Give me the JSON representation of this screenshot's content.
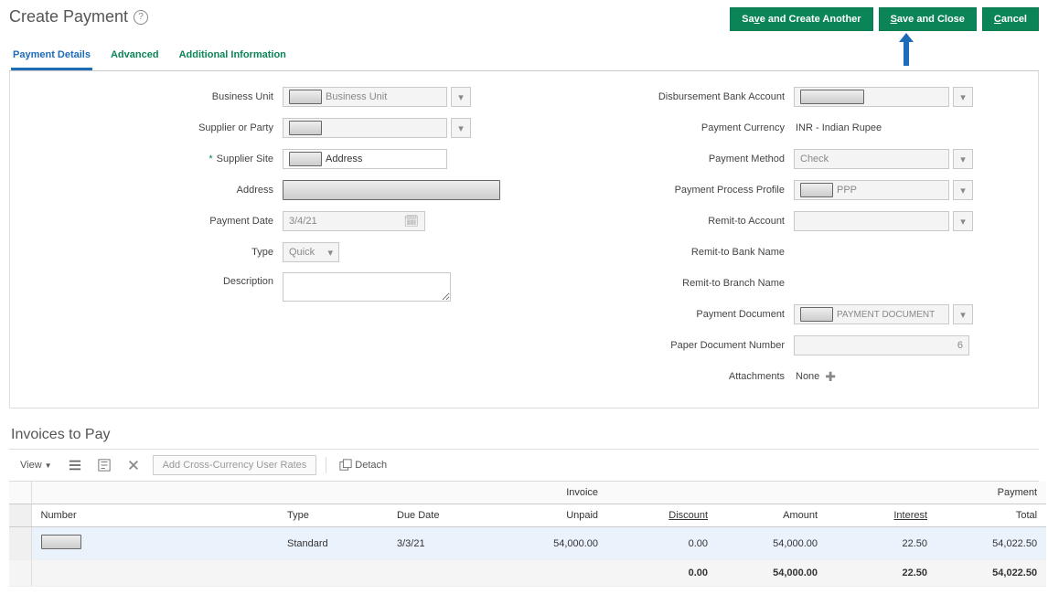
{
  "header": {
    "title": "Create Payment",
    "buttons": {
      "save_another": {
        "prefix": "Sa",
        "u": "v",
        "suffix": "e and Create Another"
      },
      "save_close": {
        "prefix": "",
        "u": "S",
        "suffix": "ave and Close"
      },
      "cancel": {
        "prefix": "",
        "u": "C",
        "suffix": "ancel"
      }
    }
  },
  "tabs": [
    "Payment Details",
    "Advanced",
    "Additional Information"
  ],
  "active_tab": 0,
  "left": {
    "business_unit": {
      "label": "Business Unit",
      "placeholder": "Business Unit"
    },
    "supplier_party": {
      "label": "Supplier or Party"
    },
    "supplier_site": {
      "label": "Supplier Site",
      "placeholder": "Address"
    },
    "address": {
      "label": "Address"
    },
    "payment_date": {
      "label": "Payment Date",
      "value": "3/4/21"
    },
    "type": {
      "label": "Type",
      "value": "Quick"
    },
    "description": {
      "label": "Description"
    }
  },
  "right": {
    "disb_bank": {
      "label": "Disbursement Bank Account"
    },
    "currency": {
      "label": "Payment Currency",
      "value": "INR - Indian Rupee"
    },
    "method": {
      "label": "Payment Method",
      "value": "Check"
    },
    "process_profile": {
      "label": "Payment Process Profile",
      "suffix": "PPP"
    },
    "remit_account": {
      "label": "Remit-to Account"
    },
    "remit_bank": {
      "label": "Remit-to Bank Name"
    },
    "remit_branch": {
      "label": "Remit-to Branch Name"
    },
    "pay_doc": {
      "label": "Payment Document",
      "suffix": "PAYMENT DOCUMENT"
    },
    "paper_doc_num": {
      "label": "Paper Document Number",
      "value": "6"
    },
    "attachments": {
      "label": "Attachments",
      "value": "None"
    }
  },
  "invoices": {
    "title": "Invoices to Pay",
    "view_label": "View",
    "add_rates_label": "Add Cross-Currency User Rates",
    "detach_label": "Detach",
    "group_heads": [
      "Invoice",
      "Payment"
    ],
    "heads": [
      "Number",
      "Type",
      "Due Date",
      "Unpaid",
      "Discount",
      "Amount",
      "Interest",
      "Total"
    ],
    "rows": [
      {
        "type": "Standard",
        "due": "3/3/21",
        "unpaid": "54,000.00",
        "discount": "0.00",
        "amount": "54,000.00",
        "interest": "22.50",
        "total": "54,022.50"
      }
    ],
    "totals": {
      "discount": "0.00",
      "amount": "54,000.00",
      "interest": "22.50",
      "total": "54,022.50"
    }
  }
}
